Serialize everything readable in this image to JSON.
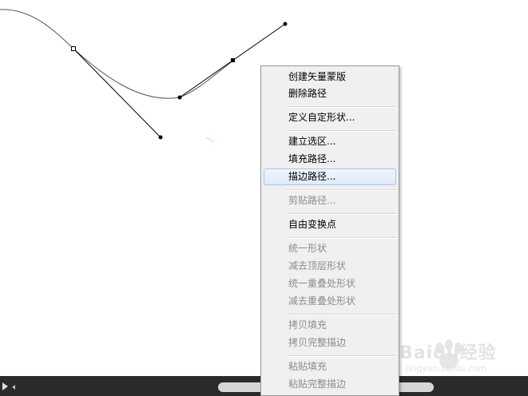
{
  "menu": {
    "items": [
      {
        "label": "创建矢量蒙版",
        "enabled": true
      },
      {
        "label": "删除路径",
        "enabled": true
      },
      {
        "label": "定义自定形状...",
        "enabled": true
      },
      {
        "label": "建立选区...",
        "enabled": true
      },
      {
        "label": "填充路径...",
        "enabled": true
      },
      {
        "label": "描边路径...",
        "enabled": true,
        "highlighted": true
      },
      {
        "label": "剪贴路径...",
        "enabled": false
      },
      {
        "label": "自由变换点",
        "enabled": true
      },
      {
        "label": "统一形状",
        "enabled": false
      },
      {
        "label": "减去顶层形状",
        "enabled": false
      },
      {
        "label": "统一重叠处形状",
        "enabled": false
      },
      {
        "label": "减去重叠处形状",
        "enabled": false
      },
      {
        "label": "拷贝填充",
        "enabled": false
      },
      {
        "label": "拷贝完整描边",
        "enabled": false
      },
      {
        "label": "粘贴填充",
        "enabled": false
      },
      {
        "label": "粘贴完整描边",
        "enabled": false
      }
    ]
  },
  "watermark": {
    "text": "Baidu经验",
    "url": "jingyan.baidu.com"
  },
  "colors": {
    "menu_background": "#f0f0f0",
    "highlight": "#dfeaf9",
    "disabled_text": "#8c8c8c",
    "bottom_bar": "#2a2a2a"
  }
}
